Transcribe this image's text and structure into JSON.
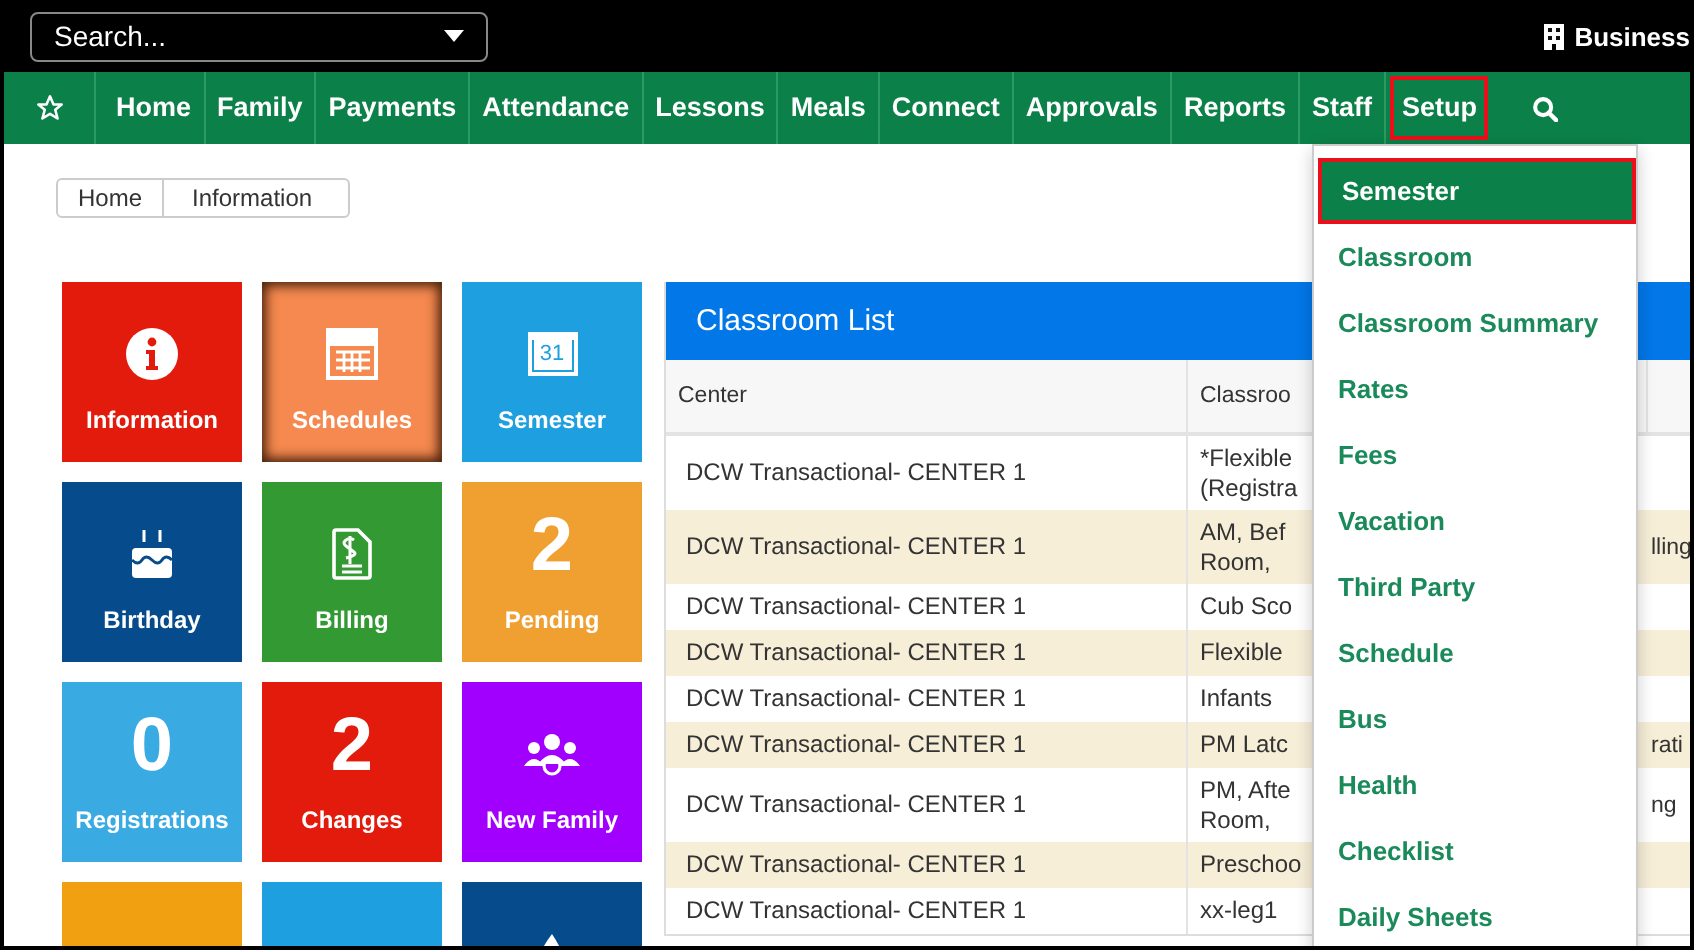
{
  "top_bar": {
    "search": {
      "placeholder": "Search..."
    },
    "business_label": "Business"
  },
  "nav": {
    "items": [
      {
        "label": "Home",
        "selected": false
      },
      {
        "label": "Family",
        "selected": false
      },
      {
        "label": "Payments",
        "selected": false
      },
      {
        "label": "Attendance",
        "selected": false
      },
      {
        "label": "Lessons",
        "selected": false
      },
      {
        "label": "Meals",
        "selected": false
      },
      {
        "label": "Connect",
        "selected": false
      },
      {
        "label": "Approvals",
        "selected": false
      },
      {
        "label": "Reports",
        "selected": false
      },
      {
        "label": "Staff",
        "selected": false
      },
      {
        "label": "Setup",
        "selected": true
      }
    ]
  },
  "breadcrumb": [
    "Home",
    "Information"
  ],
  "tiles": [
    {
      "kind": "icon",
      "label": "Information",
      "color": "#e31b0c",
      "hovered": false
    },
    {
      "kind": "icon",
      "label": "Schedules",
      "color": "#f5894f",
      "hovered": true
    },
    {
      "kind": "icon",
      "label": "Semester",
      "color": "#1e9fe0",
      "hovered": false,
      "icon_text": "31"
    },
    {
      "kind": "icon",
      "label": "Birthday",
      "color": "#064c8c",
      "hovered": false
    },
    {
      "kind": "icon",
      "label": "Billing",
      "color": "#339933",
      "hovered": false
    },
    {
      "kind": "count",
      "value": "2",
      "label": "Pending",
      "color": "#f0a030",
      "hovered": false
    },
    {
      "kind": "count",
      "value": "0",
      "label": "Registrations",
      "color": "#3aaae3",
      "hovered": false
    },
    {
      "kind": "count",
      "value": "2",
      "label": "Changes",
      "color": "#e31b0c",
      "hovered": false
    },
    {
      "kind": "icon",
      "label": "New Family",
      "color": "#a100ff",
      "hovered": false
    },
    {
      "kind": "count",
      "color": "#f0a010",
      "hovered": false
    },
    {
      "kind": "count",
      "color": "#1e9fe0",
      "hovered": false
    },
    {
      "kind": "icon",
      "color": "#064c8c",
      "hovered": false
    }
  ],
  "classroom_list": {
    "title": "Classroom List",
    "columns": [
      "Center",
      "Classroo"
    ],
    "rows": [
      {
        "center": "DCW Transactional- CENTER 1",
        "classroom": [
          "*Flexible",
          "(Registra"
        ]
      },
      {
        "center": "DCW Transactional- CENTER 1",
        "classroom": [
          "AM, Bef",
          "Room,"
        ],
        "column_3": "lling"
      },
      {
        "center": "DCW Transactional- CENTER 1",
        "classroom": [
          "Cub Sco"
        ]
      },
      {
        "center": "DCW Transactional- CENTER 1",
        "classroom": [
          "Flexible"
        ]
      },
      {
        "center": "DCW Transactional- CENTER 1",
        "classroom": [
          "Infants"
        ]
      },
      {
        "center": "DCW Transactional- CENTER 1",
        "classroom": [
          "PM Latc"
        ],
        "column_3": "rati"
      },
      {
        "center": "DCW Transactional- CENTER 1",
        "classroom": [
          "PM, Afte",
          "Room,"
        ],
        "column_3": "ng"
      },
      {
        "center": "DCW Transactional- CENTER 1",
        "classroom": [
          "Preschoo"
        ]
      },
      {
        "center": "DCW Transactional- CENTER 1",
        "classroom": [
          "xx-leg1"
        ]
      }
    ]
  },
  "setup_menu": {
    "items": [
      {
        "label": "Semester",
        "selected": true
      },
      {
        "label": "Classroom",
        "selected": false
      },
      {
        "label": "Classroom Summary",
        "selected": false
      },
      {
        "label": "Rates",
        "selected": false
      },
      {
        "label": "Fees",
        "selected": false
      },
      {
        "label": "Vacation",
        "selected": false
      },
      {
        "label": "Third Party",
        "selected": false
      },
      {
        "label": "Schedule",
        "selected": false
      },
      {
        "label": "Bus",
        "selected": false
      },
      {
        "label": "Health",
        "selected": false
      },
      {
        "label": "Checklist",
        "selected": false
      },
      {
        "label": "Daily Sheets",
        "selected": false
      }
    ]
  }
}
